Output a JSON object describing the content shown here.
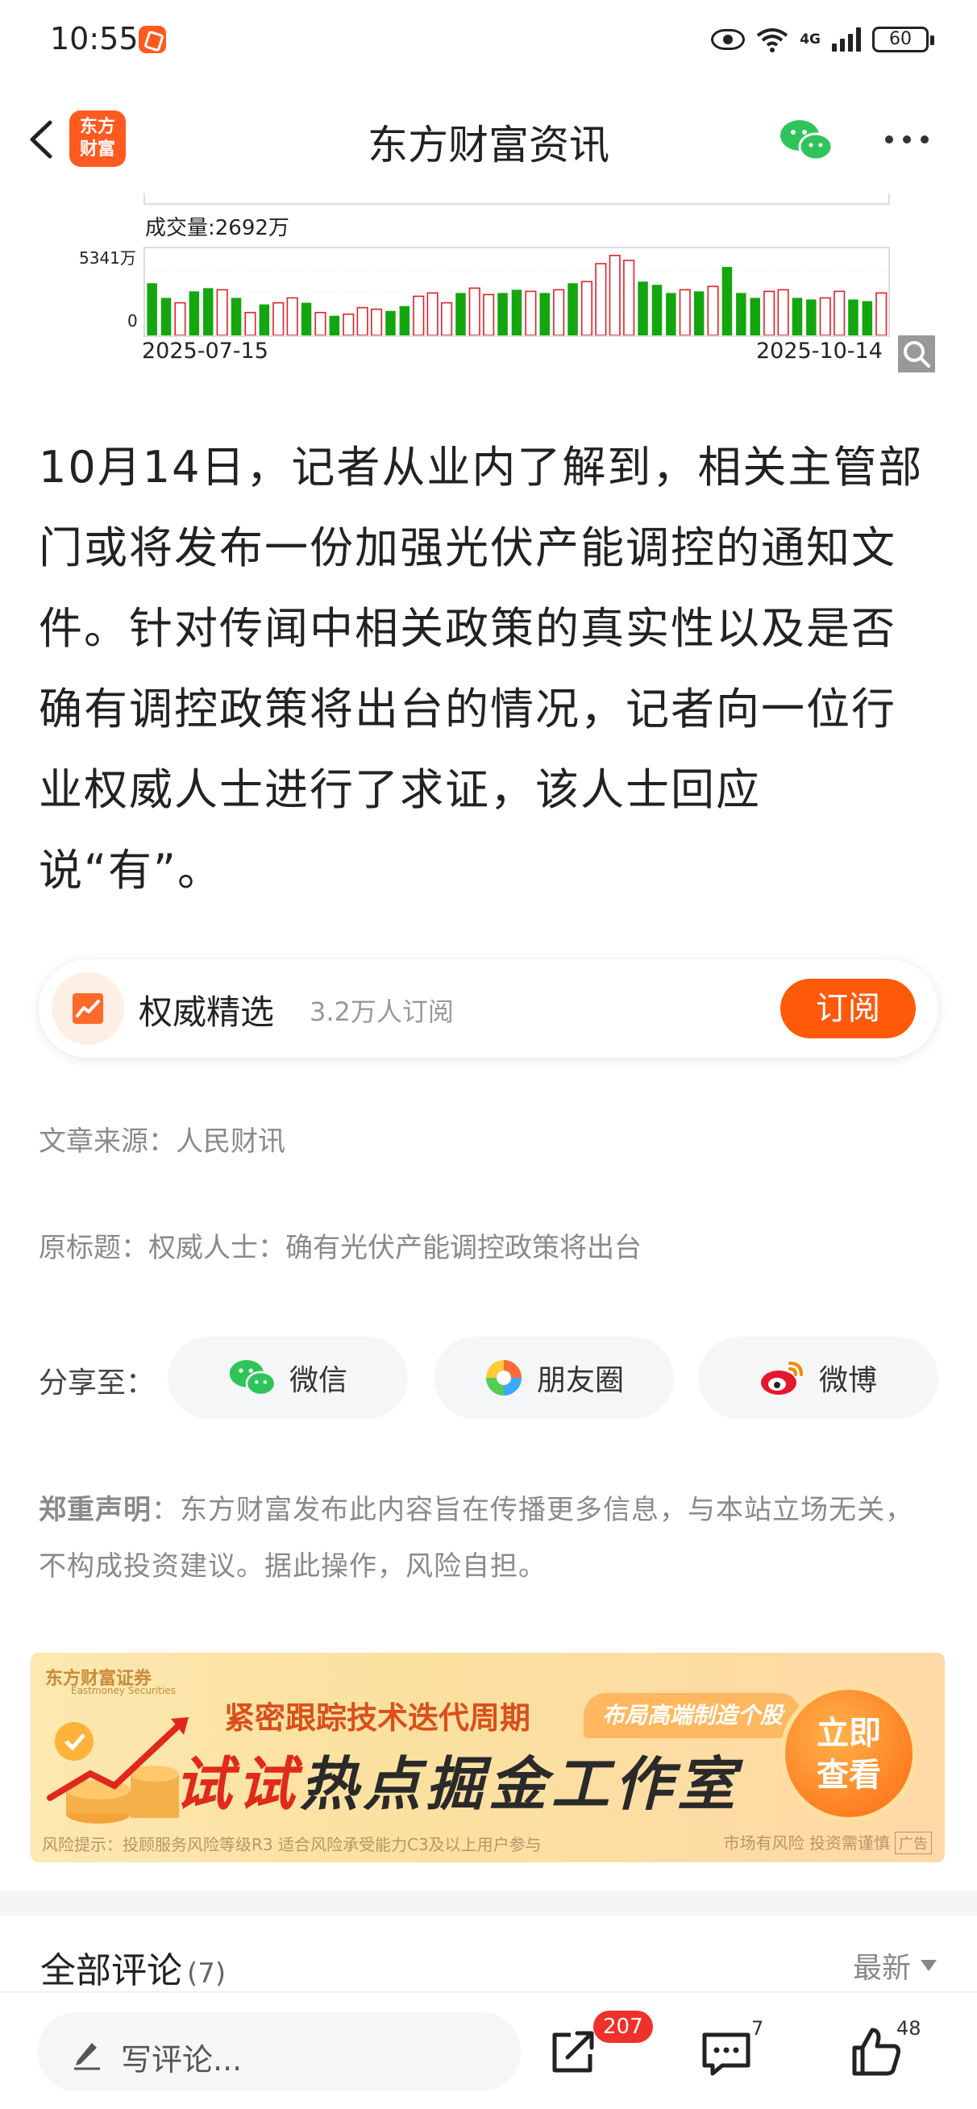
{
  "status_bar": {
    "time": "10:55",
    "network": "4G",
    "battery": "60"
  },
  "header": {
    "title": "东方财富资讯",
    "logo_text_1": "东方",
    "logo_text_2": "财富"
  },
  "chart_data": {
    "type": "bar",
    "title": "",
    "volume_label": "成交量:2692万",
    "ymax_label": "5341万",
    "ymin_label": "0",
    "x_start": "2025-07-15",
    "x_end": "2025-10-14",
    "ylim": [
      0,
      5341
    ],
    "values": [
      3200,
      2300,
      2000,
      2700,
      2900,
      2800,
      2300,
      1400,
      1900,
      2000,
      2300,
      2000,
      1400,
      1200,
      1300,
      1700,
      1600,
      1500,
      1800,
      2400,
      2600,
      2000,
      2600,
      2900,
      2500,
      2600,
      2800,
      2700,
      2600,
      2800,
      3200,
      3300,
      4400,
      4900,
      4600,
      3300,
      3100,
      2600,
      2800,
      2700,
      3000,
      4200,
      2600,
      2300,
      2700,
      2800,
      2300,
      2200,
      2300,
      2700,
      2200,
      2100,
      2600
    ],
    "colors": [
      "g",
      "g",
      "r",
      "g",
      "g",
      "r",
      "g",
      "r",
      "g",
      "r",
      "r",
      "g",
      "r",
      "g",
      "r",
      "r",
      "r",
      "g",
      "g",
      "r",
      "r",
      "r",
      "g",
      "r",
      "r",
      "g",
      "g",
      "r",
      "g",
      "r",
      "g",
      "r",
      "r",
      "r",
      "r",
      "g",
      "g",
      "g",
      "r",
      "g",
      "r",
      "g",
      "g",
      "g",
      "r",
      "r",
      "g",
      "g",
      "r",
      "r",
      "g",
      "g",
      "r"
    ]
  },
  "article": {
    "body": "10月14日，记者从业内了解到，相关主管部门或将发布一份加强光伏产能调控的通知文件。针对传闻中相关政策的真实性以及是否确有调控政策将出台的情况，记者向一位行业权威人士进行了求证，该人士回应说“有”。"
  },
  "subscribe": {
    "name": "权威精选",
    "count": "3.2万人订阅",
    "button": "订阅"
  },
  "meta": {
    "source": "文章来源：人民财讯",
    "original_title": "原标题：权威人士：确有光伏产能调控政策将出台"
  },
  "share": {
    "label": "分享至：",
    "wechat": "微信",
    "moments": "朋友圈",
    "weibo": "微博"
  },
  "disclaimer": {
    "label": "郑重声明",
    "text": "：东方财富发布此内容旨在传播更多信息，与本站立场无关，不构成投资建议。据此操作，风险自担。"
  },
  "banner": {
    "brand": "东方财富证券",
    "brand_en": "Eastmoney Securities",
    "subtitle": "紧密跟踪技术迭代周期",
    "tag": "布局高端制造个股",
    "main_prefix": "试试",
    "main_rest": "热点掘金工作室",
    "cta_1": "立即",
    "cta_2": "查看",
    "footnote": "风险提示：投顾服务风险等级R3 适合风险承受能力C3及以上用户参与",
    "risk": "市场有风险 投资需谨慎",
    "ad": "广告"
  },
  "comments": {
    "title": "全部评论",
    "count": "(7)",
    "sort": "最新"
  },
  "bottom": {
    "write_placeholder": "写评论...",
    "share_count": "207",
    "comment_count": "7",
    "like_count": "48"
  },
  "colors": {
    "accent": "#ff5a1f",
    "rise": "#e0202a",
    "fall": "#13a60f"
  }
}
